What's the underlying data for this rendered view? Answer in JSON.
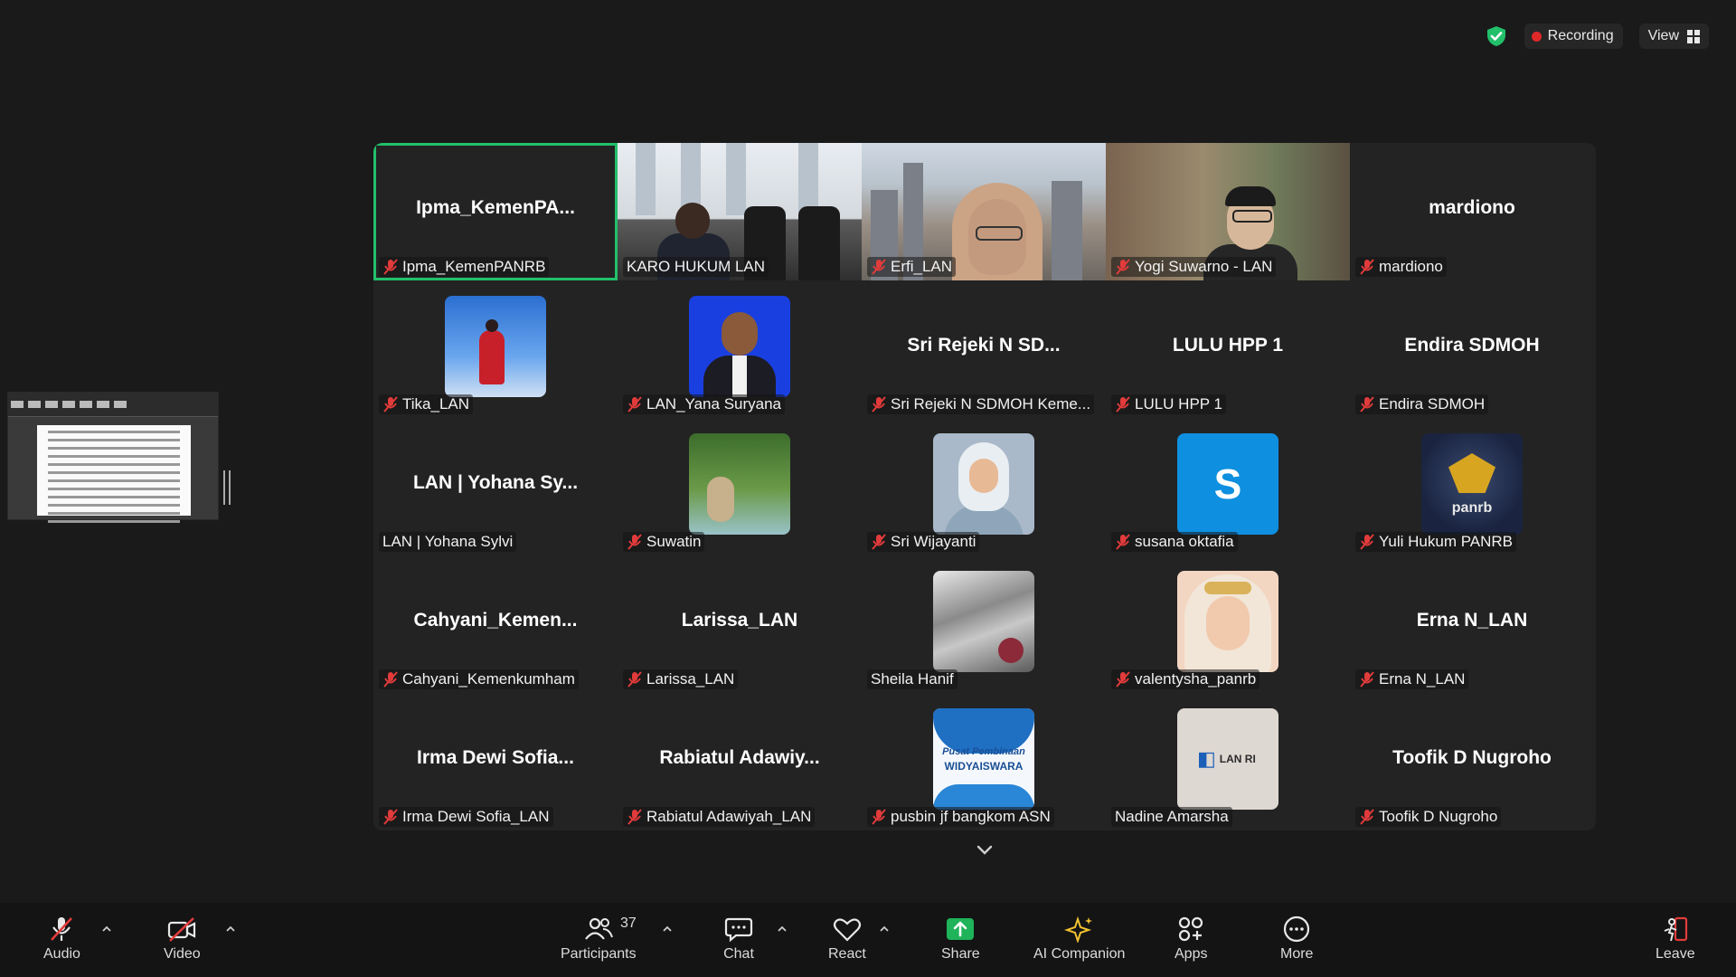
{
  "status": {
    "recording_label": "Recording",
    "view_label": "View"
  },
  "tiles": [
    {
      "name_big": "Ipma_KemenPA...",
      "label": "Ipma_KemenPANRB",
      "muted": true,
      "active": true
    },
    {
      "name_big": "",
      "label": "KARO HUKUM LAN",
      "muted": false
    },
    {
      "name_big": "",
      "label": "Erfi_LAN",
      "muted": true
    },
    {
      "name_big": "",
      "label": "Yogi Suwarno - LAN",
      "muted": true
    },
    {
      "name_big": "mardiono",
      "label": "mardiono",
      "muted": true
    },
    {
      "name_big": "",
      "label": "Tika_LAN",
      "muted": true
    },
    {
      "name_big": "",
      "label": "LAN_Yana Suryana",
      "muted": true
    },
    {
      "name_big": "Sri Rejeki N SD...",
      "label": "Sri Rejeki N SDMOH Keme...",
      "muted": true
    },
    {
      "name_big": "LULU HPP 1",
      "label": "LULU HPP 1",
      "muted": true
    },
    {
      "name_big": "Endira SDMOH",
      "label": "Endira SDMOH",
      "muted": true
    },
    {
      "name_big": "LAN | Yohana Sy...",
      "label": "LAN | Yohana Sylvi",
      "muted": false
    },
    {
      "name_big": "",
      "label": "Suwatin",
      "muted": true
    },
    {
      "name_big": "",
      "label": "Sri Wijayanti",
      "muted": true
    },
    {
      "name_big": "",
      "label": "susana oktafia",
      "muted": true,
      "avatar_letter": "S"
    },
    {
      "name_big": "",
      "label": "Yuli Hukum PANRB",
      "muted": true,
      "avatar_text": "panrb"
    },
    {
      "name_big": "Cahyani_Kemen...",
      "label": "Cahyani_Kemenkumham",
      "muted": true
    },
    {
      "name_big": "Larissa_LAN",
      "label": "Larissa_LAN",
      "muted": true
    },
    {
      "name_big": "",
      "label": "Sheila Hanif",
      "muted": false
    },
    {
      "name_big": "",
      "label": "valentysha_panrb",
      "muted": true
    },
    {
      "name_big": "Erna N_LAN",
      "label": "Erna N_LAN",
      "muted": true
    },
    {
      "name_big": "Irma Dewi Sofia...",
      "label": "Irma Dewi Sofia_LAN",
      "muted": true
    },
    {
      "name_big": "Rabiatul  Adawiy...",
      "label": "Rabiatul Adawiyah_LAN",
      "muted": true
    },
    {
      "name_big": "",
      "label": "pusbin jf bangkom ASN",
      "muted": true,
      "avatar_text": "Pusat Pembinaan",
      "avatar_text2": "WIDYAISWARA"
    },
    {
      "name_big": "",
      "label": "Nadine Amarsha",
      "muted": false,
      "avatar_text": "LAN RI"
    },
    {
      "name_big": "Toofik D Nugroho",
      "label": "Toofik D Nugroho",
      "muted": true
    }
  ],
  "toolbar": {
    "audio": "Audio",
    "video": "Video",
    "participants": "Participants",
    "participants_count": "37",
    "chat": "Chat",
    "react": "React",
    "share": "Share",
    "ai_companion": "AI Companion",
    "apps": "Apps",
    "more": "More",
    "leave": "Leave"
  },
  "colors": {
    "active_speaker": "#22c06a",
    "recording_dot": "#e02828",
    "share_green": "#1fb35a",
    "muted_red": "#e23b3b"
  }
}
